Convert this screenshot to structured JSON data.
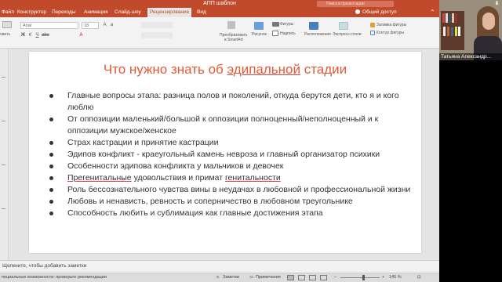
{
  "app": {
    "doc_title": "АПП шаблон",
    "search_placeholder": "Поиск в презентации",
    "share_label": "Общий доступ",
    "accent": "#c24a2c"
  },
  "tabs": [
    {
      "label": "Файл",
      "active": false
    },
    {
      "label": "Конструктор",
      "active": false
    },
    {
      "label": "Переходы",
      "active": false
    },
    {
      "label": "Анимация",
      "active": false
    },
    {
      "label": "Слайд-шоу",
      "active": false
    },
    {
      "label": "Рецензирование",
      "active": true
    },
    {
      "label": "Вид",
      "active": false
    }
  ],
  "ribbon": {
    "layout_label": "овить",
    "font_name": "Arial",
    "font_size": "18",
    "smartart_label_1": "Преобразовать",
    "smartart_label_2": "в SmartArt",
    "picture_label": "Рисунок",
    "shapes_label": "Фигуры",
    "textbox_label": "Надпись",
    "arrange_label": "Расположение",
    "quick_styles_label": "Экспресс-стили",
    "fill_label": "Заливка фигуры",
    "outline_label": "Контур фигуры"
  },
  "slide": {
    "title_before": "Что нужно знать об ",
    "title_underlined": "эдипальной",
    "title_after": " стадии",
    "title_color": "#e25a34",
    "bullets": [
      {
        "parts": [
          {
            "t": "Главные вопросы этапа: разница полов и поколений, откуда берутся дети, кто я и кого люблю",
            "u": false
          }
        ]
      },
      {
        "parts": [
          {
            "t": "От оппозиции маленький/большой к оппозиции полноценный/неполноценный и к оппозиции мужское/женское",
            "u": false
          }
        ]
      },
      {
        "parts": [
          {
            "t": "Страх кастрации и принятие кастрации",
            "u": false
          }
        ]
      },
      {
        "parts": [
          {
            "t": "Эдипов конфликт - краеугольный камень невроза и главный организатор психики",
            "u": false
          }
        ]
      },
      {
        "parts": [
          {
            "t": "Особенности эдипова конфликта у мальчиков и девочек",
            "u": false
          }
        ]
      },
      {
        "parts": [
          {
            "t": "Прегенитальные",
            "u": true
          },
          {
            "t": " удовольствия и примат ",
            "u": false
          },
          {
            "t": "генитальности",
            "u": true
          }
        ]
      },
      {
        "parts": [
          {
            "t": "Роль бессознательного чувства вины в неудачах в любовной и профессиональной жизни",
            "u": false
          }
        ]
      },
      {
        "parts": [
          {
            "t": "Любовь и ненависть, ревность и соперничество в любовном треугольнике",
            "u": false
          }
        ]
      },
      {
        "parts": [
          {
            "t": "Способность любить и сублимация как главные достижения этапа",
            "u": false
          }
        ]
      }
    ]
  },
  "notes": {
    "placeholder": "Щелкните, чтобы добавить заметки"
  },
  "status": {
    "accessibility": "пециальные возможности: проверьте рекомендации",
    "notes_label": "Заметки",
    "comments_label": "Примечания",
    "zoom": "145 %"
  },
  "webcam": {
    "name": "Татьяна Александр..."
  }
}
